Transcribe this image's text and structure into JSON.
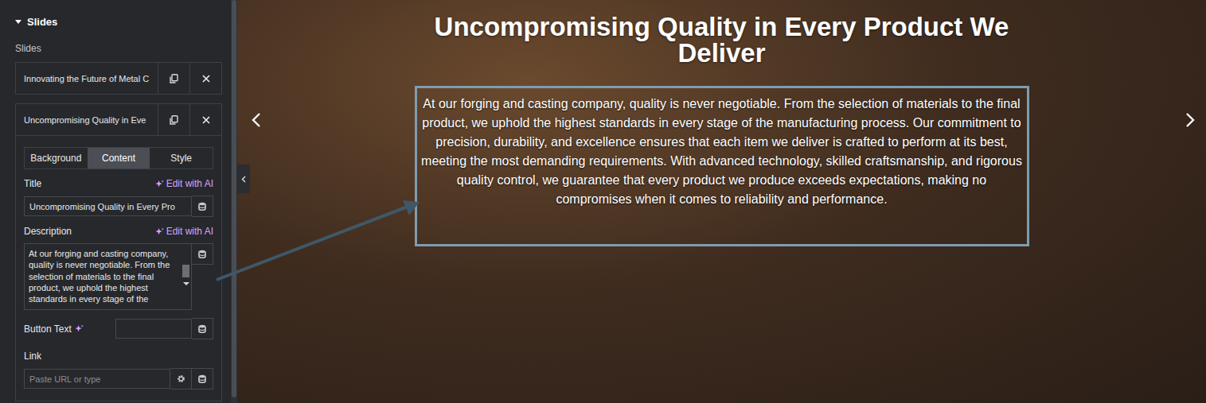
{
  "panel": {
    "section_title": "Slides",
    "expanded": true,
    "list_label": "Slides"
  },
  "slides": [
    {
      "title": "Innovating the Future of Metal C",
      "expanded": false
    },
    {
      "title": "Uncompromising Quality in Eve",
      "expanded": true
    }
  ],
  "tabs": [
    {
      "label": "Background",
      "selected": false
    },
    {
      "label": "Content",
      "selected": true
    },
    {
      "label": "Style",
      "selected": false
    }
  ],
  "fields": {
    "title": {
      "label": "Title",
      "ai": "Edit with AI",
      "value": "Uncompromising Quality in Every Pro"
    },
    "description": {
      "label": "Description",
      "ai": "Edit with AI",
      "value": "At our forging and casting company, quality is never negotiable. From the selection of materials to the final product, we uphold the highest standards in every stage of the"
    },
    "button_text": {
      "label": "Button Text",
      "value": ""
    },
    "link": {
      "label": "Link",
      "placeholder": "Paste URL or type"
    }
  },
  "preview": {
    "title": "Uncompromising Quality in Every Product We Deliver",
    "description": "At our forging and casting company, quality is never negotiable. From the selection of materials to the final product, we uphold the highest standards in every stage of the manufacturing process. Our commitment to precision, durability, and excellence ensures that each item we deliver is crafted to perform at its best, meeting the most demanding requirements. With advanced technology, skilled craftsmanship, and rigorous quality control, we guarantee that every product we produce exceeds expectations, making no compromises when it comes to reliability and performance.",
    "description_selected": true
  }
}
